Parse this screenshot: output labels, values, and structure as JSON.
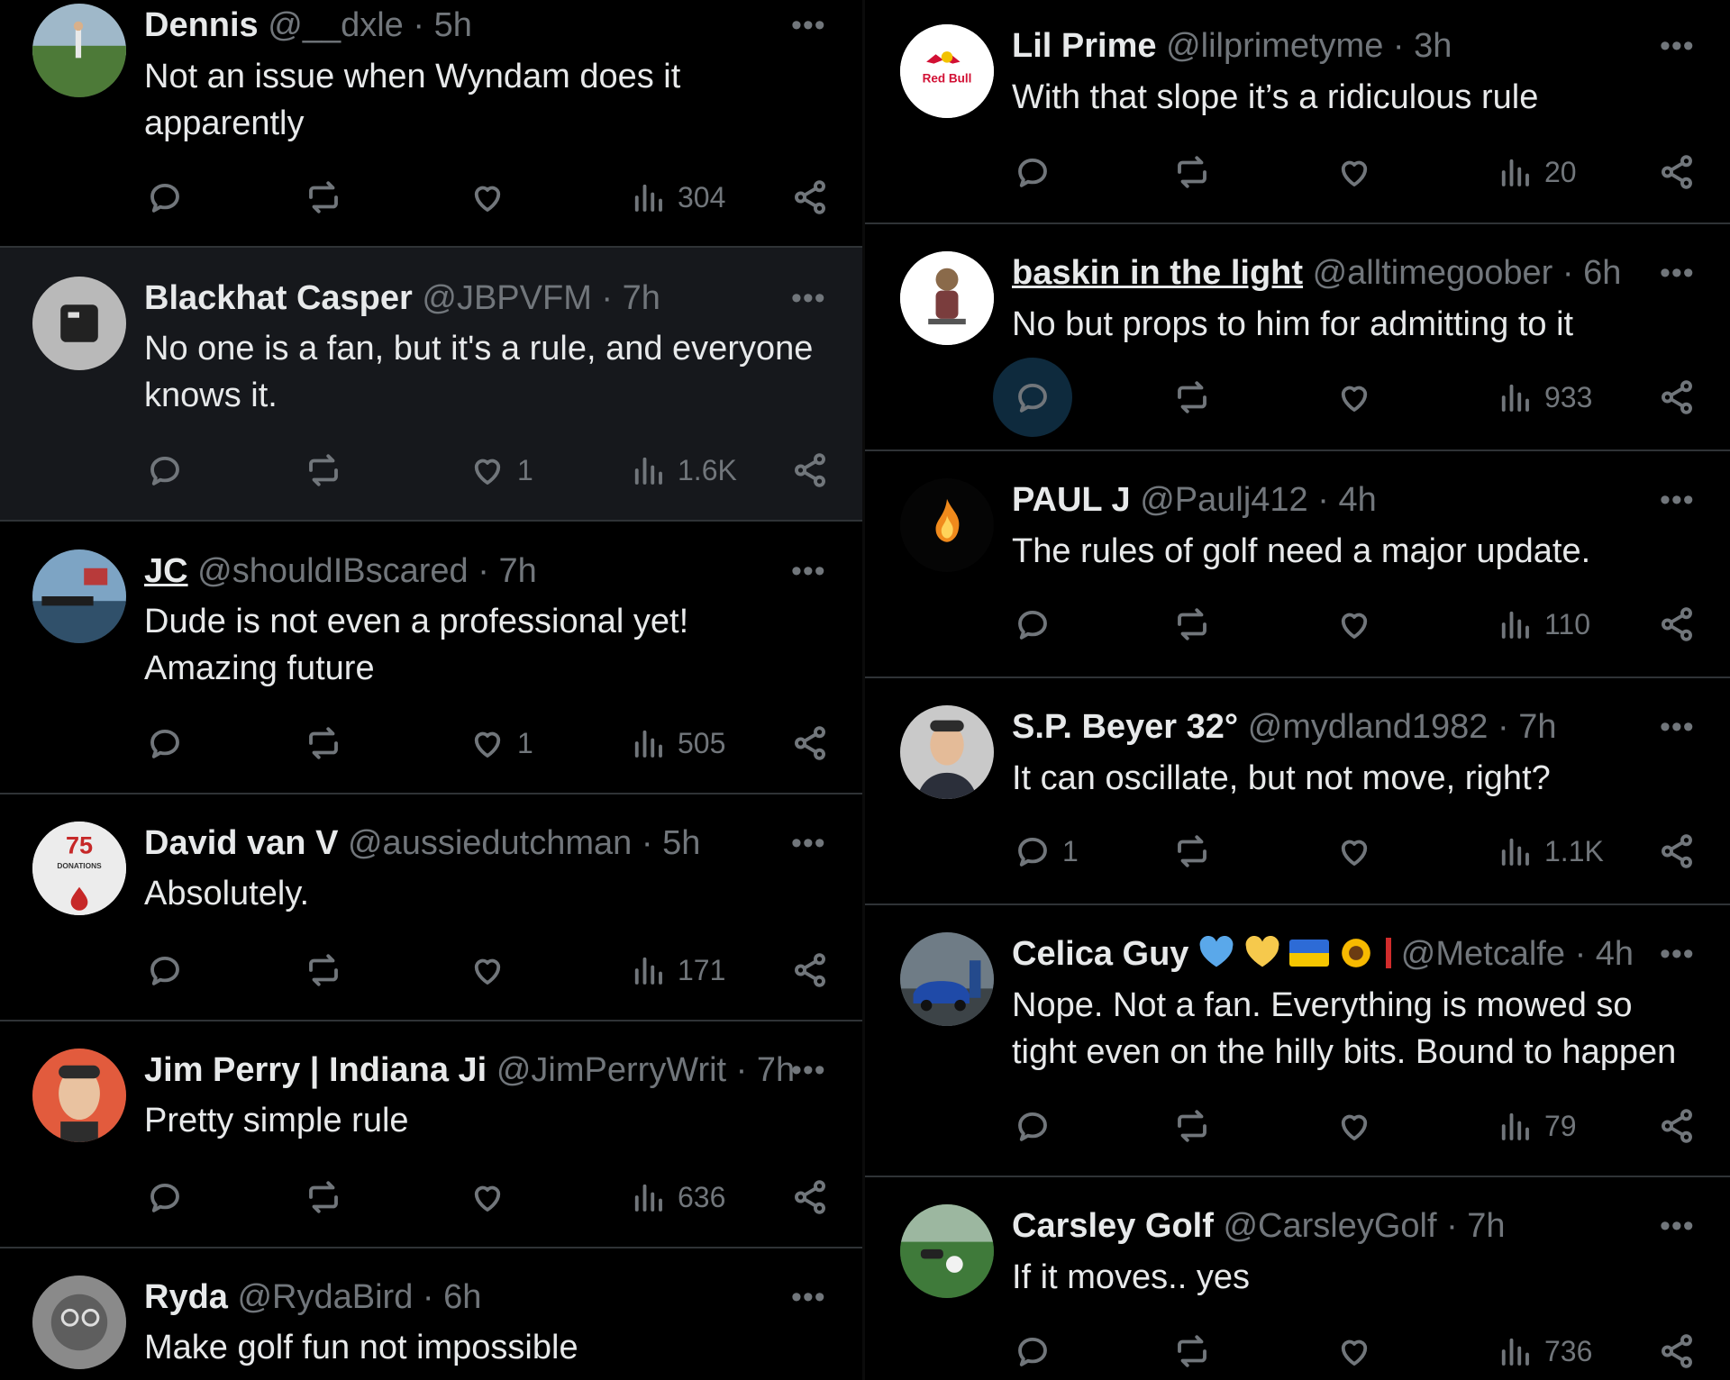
{
  "left_column": [
    {
      "name": "Dennis",
      "handle": "@__dxle",
      "time": "5h",
      "text": [
        "Not an issue when Wyndam does it",
        "apparently"
      ],
      "replies": "",
      "likes": "",
      "views": "304",
      "avatar": "golfer-on-course-avatar"
    },
    {
      "name": "Blackhat Casper",
      "handle": "@JBPVFM",
      "time": "7h",
      "text": [
        "No one is a fan, but it's a rule, and everyone",
        "knows it."
      ],
      "replies": "",
      "likes": "1",
      "views": "1.6K",
      "avatar": "golf-bag-avatar"
    },
    {
      "name": "JC",
      "handle": "@shouldIBscared",
      "time": "7h",
      "text": [
        "Dude is not even a professional yet!",
        "Amazing future"
      ],
      "replies": "",
      "likes": "1",
      "views": "505",
      "avatar": "boat-flag-avatar"
    },
    {
      "name": "David van V",
      "handle": "@aussiedutchman",
      "time": "5h",
      "text": [
        "Absolutely."
      ],
      "replies": "",
      "likes": "",
      "views": "171",
      "avatar": "donations-badge-avatar",
      "avatar_text": {
        "number": "75",
        "label": "DONATIONS"
      }
    },
    {
      "name": "Jim Perry | Indiana Ji",
      "handle": "@JimPerryWrit",
      "time": "7h",
      "text": [
        "Pretty simple rule"
      ],
      "replies": "",
      "likes": "",
      "views": "636",
      "avatar": "man-portrait-avatar"
    },
    {
      "name": "Ryda",
      "handle": "@RydaBird",
      "time": "6h",
      "text": [
        "Make golf fun not impossible"
      ],
      "replies": "",
      "likes": "",
      "views": "",
      "avatar": "sketch-face-avatar"
    }
  ],
  "right_column": [
    {
      "name": "Lil Prime",
      "handle": "@lilprimetyme",
      "time": "3h",
      "text": [
        "With that slope it’s a ridiculous rule"
      ],
      "replies": "",
      "likes": "",
      "views": "20",
      "avatar": "red-bull-logo-avatar",
      "avatar_text": {
        "logo": "Red Bull"
      }
    },
    {
      "name": "baskin in the light",
      "handle": "@alltimegoober",
      "time": "6h",
      "text": [
        "No but props to him for admitting to it"
      ],
      "replies": "",
      "likes": "",
      "views": "933",
      "avatar": "cartoon-character-avatar"
    },
    {
      "name": "PAUL J",
      "handle": "@Paulj412",
      "time": "4h",
      "text": [
        "The rules of golf need a major update."
      ],
      "replies": "",
      "likes": "",
      "views": "110",
      "avatar": "campfire-avatar"
    },
    {
      "name": "S.P. Beyer 32°",
      "handle": "@mydland1982",
      "time": "7h",
      "text": [
        "It can oscillate, but not move, right?"
      ],
      "replies": "1",
      "likes": "",
      "views": "1.1K",
      "avatar": "man-suit-avatar"
    },
    {
      "name": "Celica Guy",
      "handle": "@Metcalfe",
      "time": "4h",
      "text": [
        "Nope. Not a fan. Everything is mowed so",
        "tight even on the hilly bits. Bound to happen"
      ],
      "replies": "",
      "likes": "",
      "views": "79",
      "avatar": "car-avatar",
      "name_emojis": [
        "blue-heart",
        "yellow-heart",
        "ukraine-flag",
        "sunflower",
        "red-bar"
      ]
    },
    {
      "name": "Carsley Golf",
      "handle": "@CarsleyGolf",
      "time": "7h",
      "text": [
        "If it moves.. yes"
      ],
      "replies": "",
      "likes": "",
      "views": "736",
      "avatar": "golf-ball-avatar"
    }
  ],
  "colors": {
    "background": "#000000",
    "text": "#e7e9ea",
    "muted": "#71767b",
    "divider": "#2f3336",
    "highlight": "#16181c",
    "reply_highlight": "#0e2a3d"
  },
  "ui": {
    "dot": "·",
    "more": "•••"
  }
}
